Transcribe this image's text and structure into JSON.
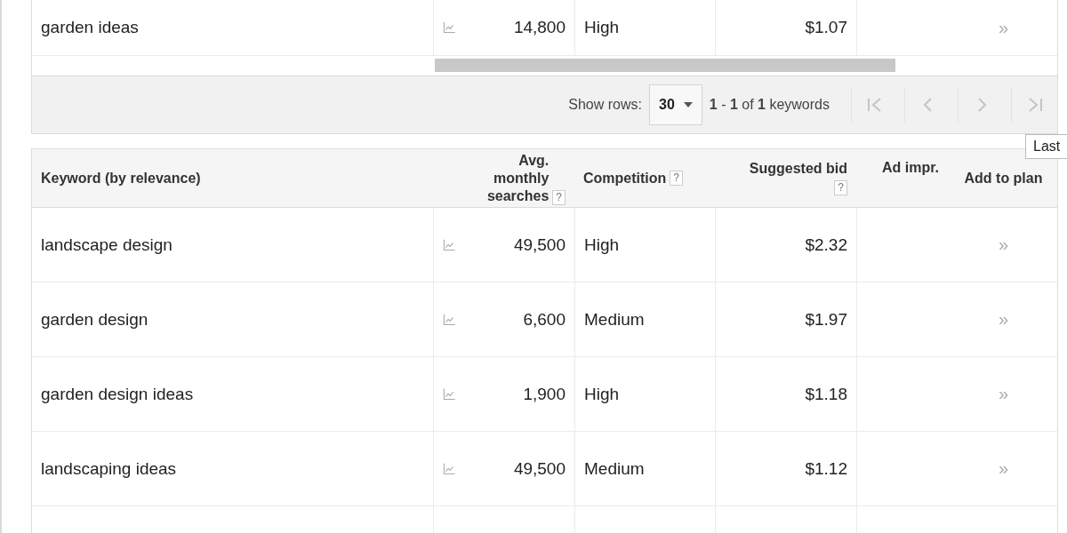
{
  "top_table": {
    "rows": [
      {
        "keyword": "garden ideas",
        "searches": "14,800",
        "competition": "High",
        "bid": "$1.07",
        "add": "»"
      }
    ]
  },
  "pager": {
    "show_rows_label": "Show rows:",
    "rows_value": "30",
    "range": "**1** - **1** of **1** keywords"
  },
  "tooltip": "Last",
  "table": {
    "columns": [
      "Keyword (by relevance)",
      "Avg. monthly searches",
      "Competition",
      "Suggested bid",
      "Ad impr.",
      "Add to plan"
    ],
    "help_marks": [
      "?",
      "?",
      "?"
    ],
    "rows": [
      {
        "keyword": "landscape design",
        "searches": "49,500",
        "competition": "High",
        "bid": "$2.32",
        "add": "»"
      },
      {
        "keyword": "garden design",
        "searches": "6,600",
        "competition": "Medium",
        "bid": "$1.97",
        "add": "»"
      },
      {
        "keyword": "garden design ideas",
        "searches": "1,900",
        "competition": "High",
        "bid": "$1.18",
        "add": "»"
      },
      {
        "keyword": "landscaping ideas",
        "searches": "49,500",
        "competition": "Medium",
        "bid": "$1.12",
        "add": "»"
      }
    ]
  }
}
